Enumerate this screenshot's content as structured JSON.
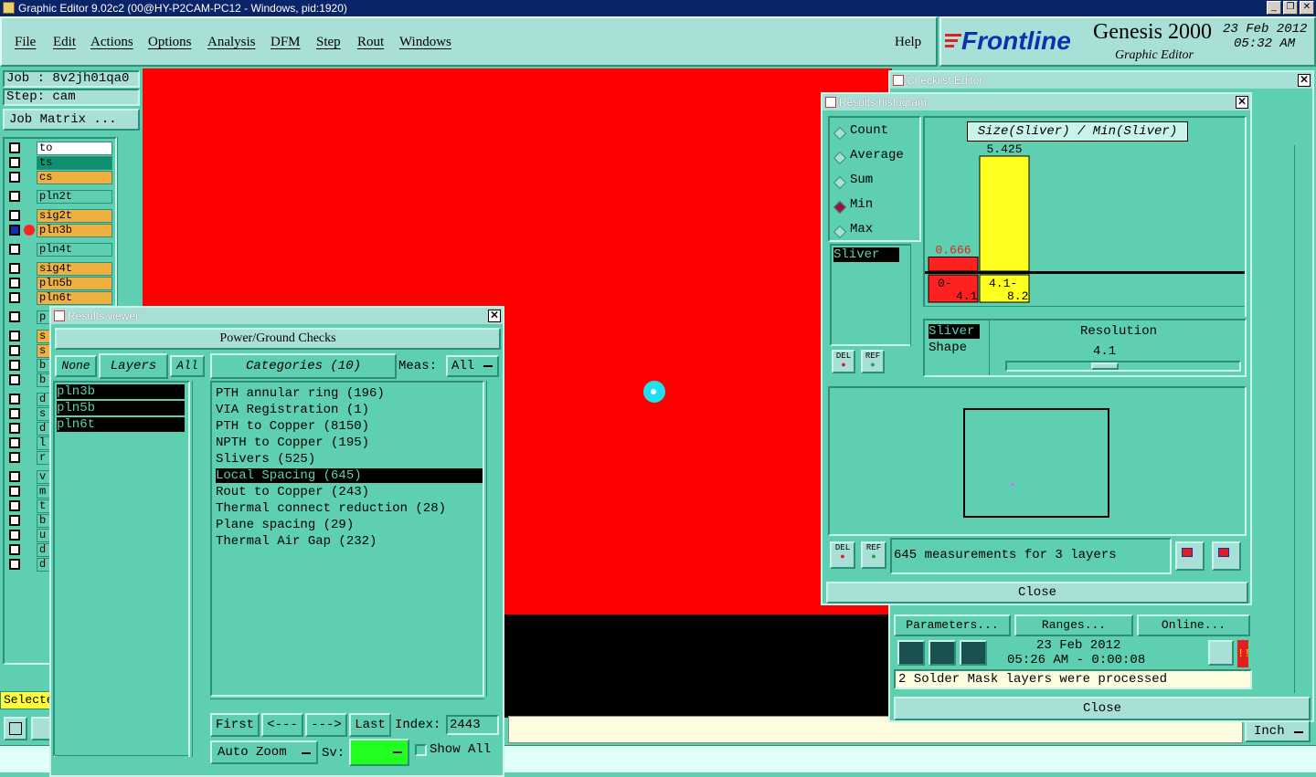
{
  "app": {
    "title": "Graphic Editor 9.02c2 (00@HY-P2CAM-PC12 - Windows, pid:1920)",
    "win_buttons": [
      "_",
      "❐",
      "✕"
    ]
  },
  "menu": {
    "items": [
      "File",
      "Edit",
      "Actions",
      "Options",
      "Analysis",
      "DFM",
      "Step",
      "Rout",
      "Windows"
    ],
    "help": "Help"
  },
  "logo": {
    "brand": "Frontline",
    "product": "Genesis 2000",
    "sub": "Graphic Editor",
    "date": "23 Feb 2012",
    "time": "05:32 AM"
  },
  "job": {
    "job": "Job : 8v2jh01qa0",
    "step": "Step: cam",
    "matrix_button": "Job Matrix ..."
  },
  "layers": [
    {
      "name": "to",
      "color": "#ffffff"
    },
    {
      "name": "ts",
      "color": "#0f9070"
    },
    {
      "name": "cs",
      "color": "#f0b040"
    },
    {
      "name": "pln2t",
      "color": "#5ecfb0"
    },
    {
      "name": "sig2t",
      "color": "#f0b040"
    },
    {
      "name": "pln3b",
      "color": "#f0b040"
    },
    {
      "name": "pln4t",
      "color": "#5ecfb0"
    },
    {
      "name": "sig4t",
      "color": "#f0b040"
    },
    {
      "name": "pln5b",
      "color": "#f0b040"
    },
    {
      "name": "pln6t",
      "color": "#f0b040"
    }
  ],
  "left_partial": [
    "p",
    "s",
    "s",
    "b",
    "b",
    "d",
    "s",
    "d",
    "l",
    "r",
    "v",
    "m",
    "t",
    "b",
    "u",
    "d",
    "d"
  ],
  "select_label": "Selecte",
  "results_viewer": {
    "title": "Results viewer",
    "header": "Power/Ground Checks",
    "none": "None",
    "layers": "Layers",
    "all": "All",
    "categories": "Categories (10)",
    "meas_label": "Meas:",
    "meas_value": "All",
    "layer_list": [
      "pln3b",
      "pln5b",
      "pln6t"
    ],
    "category_list": [
      "PTH annular ring (196)",
      "VIA Registration (1)",
      "PTH to Copper (8150)",
      "NPTH to Copper (195)",
      "Slivers (525)",
      "Local Spacing (645)",
      "Rout to Copper (243)",
      "Thermal connect reduction (28)",
      "Plane spacing (29)",
      "Thermal Air Gap (232)"
    ],
    "selected_category": "Local Spacing (645)",
    "first": "First",
    "prev": "<---",
    "next": "--->",
    "last": "Last",
    "index_label": "Index:",
    "index_value": "2443",
    "auto_zoom": "Auto Zoom",
    "sv": "Sv:",
    "show_all": "Show All"
  },
  "checklist": {
    "title": "Checklist Editor",
    "params": "Parameters...",
    "ranges": "Ranges...",
    "online": "Online...",
    "date": "23 Feb 2012",
    "time": "05:26 AM - 0:00:08",
    "status": "2 Solder Mask layers were processed",
    "close": "Close",
    "unit": "Inch"
  },
  "histogram": {
    "title": "Results histogram",
    "modes": [
      {
        "label": "Count",
        "on": false
      },
      {
        "label": "Average",
        "on": false
      },
      {
        "label": "Sum",
        "on": false
      },
      {
        "label": "Min",
        "on": true
      },
      {
        "label": "Max",
        "on": false
      }
    ],
    "attr_list": [
      "Sliver"
    ],
    "chart_label": "Size(Sliver) / Min(Sliver)",
    "del": "DEL",
    "ref": "REF",
    "shape_list": [
      "Sliver",
      "Shape"
    ],
    "resolution_label": "Resolution",
    "resolution_value": "4.1",
    "summary": "645 measurements for 3 layers",
    "close": "Close"
  },
  "chart_data": {
    "type": "bar",
    "categories": [
      "0-\n4.1",
      "4.1-\n8.2"
    ],
    "values": [
      0.666,
      5.425
    ],
    "value_labels": [
      "0.666",
      "5.425"
    ],
    "colors": [
      "#ff2020",
      "#ffff20"
    ],
    "title": "Size(Sliver) / Min(Sliver)",
    "ylim": [
      0,
      5.425
    ]
  }
}
